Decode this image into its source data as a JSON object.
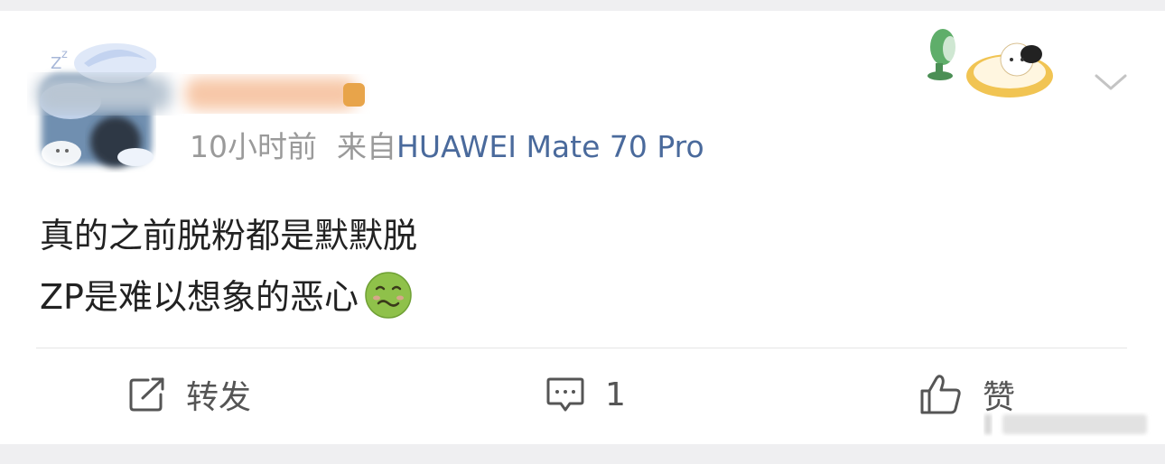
{
  "post": {
    "meta": {
      "time": "10小时前",
      "source_prefix": "来自",
      "device": "HUAWEI Mate 70 Pro"
    },
    "content": {
      "line1": "真的之前脱粉都是默默脱",
      "line2": "ZP是难以想象的恶心"
    },
    "emoji": "nauseated-face-emoji"
  },
  "actions": {
    "repost_label": "转发",
    "comment_count": "1",
    "like_label": "赞"
  },
  "colors": {
    "text": "#222222",
    "meta": "#9a9a9a",
    "device_link": "#4a6a9c",
    "icon": "#555555",
    "page_bg": "#efeff1"
  }
}
